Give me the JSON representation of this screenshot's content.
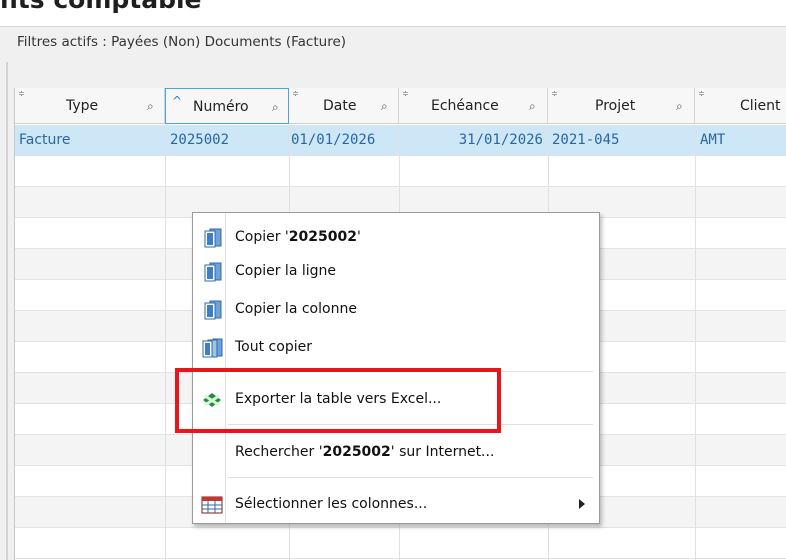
{
  "page_title": "nts comptable",
  "filters": {
    "text": "Filtres actifs : Payées (Non) Documents (Facture)"
  },
  "columns": [
    "Type",
    "Numéro",
    "Date",
    "Echéance",
    "Projet",
    "Client"
  ],
  "rows": [
    {
      "type": "Facture",
      "numero": "2025002",
      "date": "01/01/2026",
      "echeance": "31/01/2026",
      "projet": "2021-045",
      "client": "AMT"
    }
  ],
  "context_menu": {
    "copy_value": {
      "before": "Copier '",
      "value": "2025002",
      "after": "'"
    },
    "copy_row": "Copier la ligne",
    "copy_column": "Copier la colonne",
    "copy_all": "Tout copier",
    "export_excel": "Exporter la table vers Excel...",
    "search_web": {
      "before": "Rechercher '",
      "value": "2025002",
      "after": "' sur Internet..."
    },
    "select_columns": "Sélectionner les colonnes..."
  },
  "colors": {
    "selected_row": "#cde7f7",
    "link_text": "#2a66a3",
    "highlight": "#e8161a"
  }
}
